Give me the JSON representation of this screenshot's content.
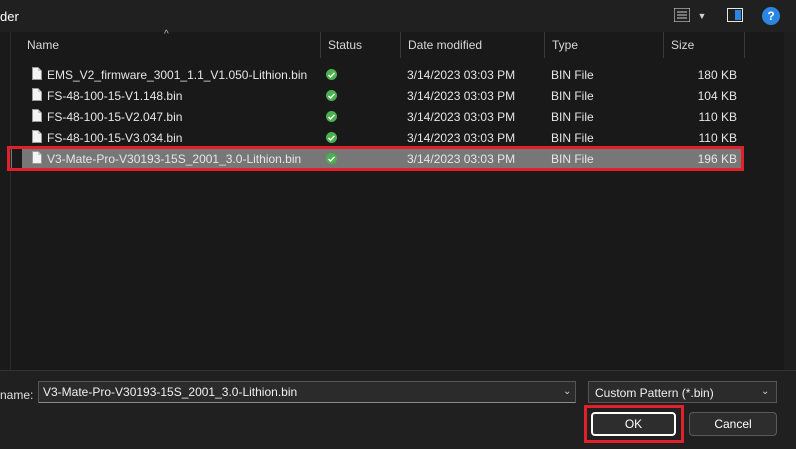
{
  "window": {
    "title": "der"
  },
  "toolbar": {
    "view_icon": "list-view-icon",
    "preview_icon": "preview-pane-icon",
    "help_label": "?"
  },
  "columns": {
    "name": "Name",
    "status": "Status",
    "date_modified": "Date modified",
    "type": "Type",
    "size": "Size"
  },
  "files": [
    {
      "name": "EMS_V2_firmware_3001_1.1_V1.050-Lithion.bin",
      "date": "3/14/2023 03:03 PM",
      "type": "BIN File",
      "size": "180 KB"
    },
    {
      "name": "FS-48-100-15-V1.148.bin",
      "date": "3/14/2023 03:03 PM",
      "type": "BIN File",
      "size": "104 KB"
    },
    {
      "name": "FS-48-100-15-V2.047.bin",
      "date": "3/14/2023 03:03 PM",
      "type": "BIN File",
      "size": "110 KB"
    },
    {
      "name": "FS-48-100-15-V3.034.bin",
      "date": "3/14/2023 03:03 PM",
      "type": "BIN File",
      "size": "110 KB"
    },
    {
      "name": "V3-Mate-Pro-V30193-15S_2001_3.0-Lithion.bin",
      "date": "3/14/2023 03:03 PM",
      "type": "BIN File",
      "size": "196 KB",
      "selected": true
    }
  ],
  "footer": {
    "filename_label": "name:",
    "filename_value": "V3-Mate-Pro-V30193-15S_2001_3.0-Lithion.bin",
    "filter_value": "Custom Pattern (*.bin)",
    "ok_label": "OK",
    "cancel_label": "Cancel"
  },
  "colors": {
    "highlight": "#e0202a",
    "status_ok": "#4caf50",
    "selected_row": "#777777"
  }
}
